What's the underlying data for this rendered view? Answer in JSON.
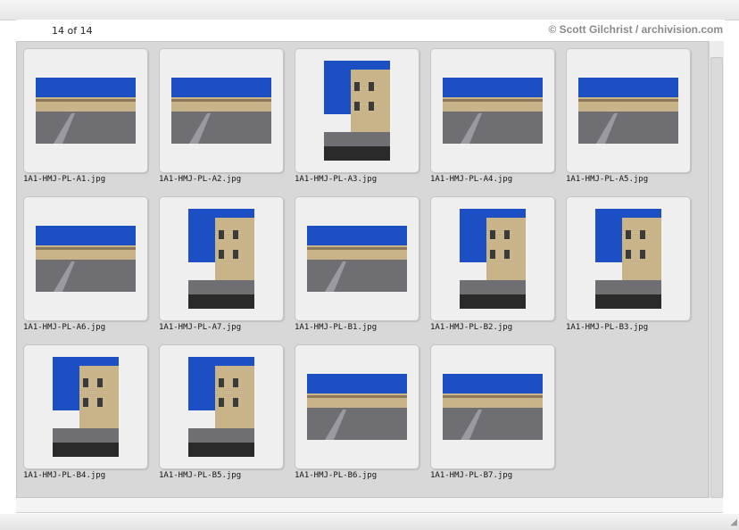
{
  "header": {
    "count_text": "14 of 14",
    "credit_text": "© Scott Gilchrist / archivision.com"
  },
  "thumbnails": [
    {
      "filename": "1A1-HMJ-PL-A1.jpg",
      "orientation": "landscape"
    },
    {
      "filename": "1A1-HMJ-PL-A2.jpg",
      "orientation": "landscape"
    },
    {
      "filename": "1A1-HMJ-PL-A3.jpg",
      "orientation": "portrait"
    },
    {
      "filename": "1A1-HMJ-PL-A4.jpg",
      "orientation": "landscape"
    },
    {
      "filename": "1A1-HMJ-PL-A5.jpg",
      "orientation": "landscape"
    },
    {
      "filename": "1A1-HMJ-PL-A6.jpg",
      "orientation": "landscape"
    },
    {
      "filename": "1A1-HMJ-PL-A7.jpg",
      "orientation": "portrait"
    },
    {
      "filename": "1A1-HMJ-PL-B1.jpg",
      "orientation": "landscape"
    },
    {
      "filename": "1A1-HMJ-PL-B2.jpg",
      "orientation": "portrait"
    },
    {
      "filename": "1A1-HMJ-PL-B3.jpg",
      "orientation": "portrait"
    },
    {
      "filename": "1A1-HMJ-PL-B4.jpg",
      "orientation": "portrait"
    },
    {
      "filename": "1A1-HMJ-PL-B5.jpg",
      "orientation": "portrait"
    },
    {
      "filename": "1A1-HMJ-PL-B6.jpg",
      "orientation": "landscape"
    },
    {
      "filename": "1A1-HMJ-PL-B7.jpg",
      "orientation": "landscape"
    }
  ],
  "colors": {
    "sky": "#1c4fc4",
    "stone": "#c9b48a",
    "pavement": "#6f6f73",
    "shadow": "#2a2a2a"
  }
}
